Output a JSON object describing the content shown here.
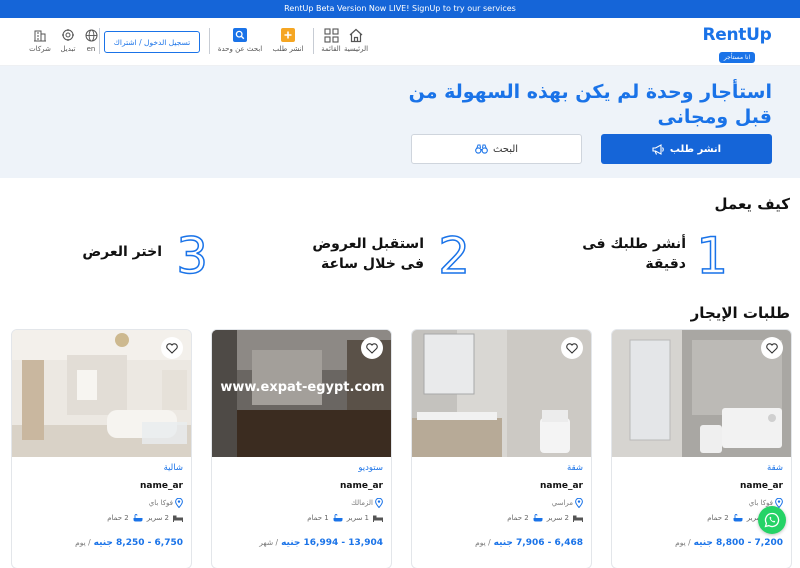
{
  "banner": {
    "text": "RentUp Beta Version Now LIVE! SignUp to try our services"
  },
  "header": {
    "logo_text": "RentUp",
    "logo_badge": "انا مستأجر",
    "nav": {
      "home": "الرئيسية",
      "list": "القائمة",
      "post": "انشر طلب",
      "search": "ابحث عن وحدة",
      "language": "en",
      "switch": "تبديل",
      "companies": "شركات"
    },
    "login_label": "تسجيل الدخول / اشتراك"
  },
  "hero": {
    "title": "استأجار وحدة لم يكن بهذه السهولة من قبل ومجانى",
    "post_button": "انشر طلب",
    "search_button": "البحث"
  },
  "how": {
    "title": "كيف يعمل",
    "steps": [
      {
        "num": "1",
        "text": "أنشر طلبك فى دقيقة"
      },
      {
        "num": "2",
        "text": "استقبل العروض فى خلال ساعة"
      },
      {
        "num": "3",
        "text": "اختر العرض"
      }
    ]
  },
  "requests": {
    "title": "طلبات الإيجار",
    "cards": [
      {
        "type": "شقة",
        "name": "name_ar",
        "location": "فوكا باي",
        "rooms": "1 سرير",
        "baths": "2 حمام",
        "price": "7,200 - 8,800 جنيه",
        "period": "/ يوم"
      },
      {
        "type": "شقة",
        "name": "name_ar",
        "location": "مراسي",
        "rooms": "2 سرير",
        "baths": "2 حمام",
        "price": "6,468 - 7,906 جنيه",
        "period": "/ يوم"
      },
      {
        "type": "ستوديو",
        "name": "name_ar",
        "location": "الزمالك",
        "rooms": "1 سرير",
        "baths": "1 حمام",
        "price": "13,904 - 16,994 جنيه",
        "period": "/ شهر",
        "watermark": "www.expat-egypt.com"
      },
      {
        "type": "شالية",
        "name": "name_ar",
        "location": "فوكا باي",
        "rooms": "2 سرير",
        "baths": "2 حمام",
        "price": "6,750 - 8,250 جنيه",
        "period": "/ يوم"
      }
    ]
  },
  "colors": {
    "brand": "#1a73e8",
    "banner": "#1565d8",
    "hero_bg": "#eef3f9",
    "whatsapp": "#25d366"
  }
}
